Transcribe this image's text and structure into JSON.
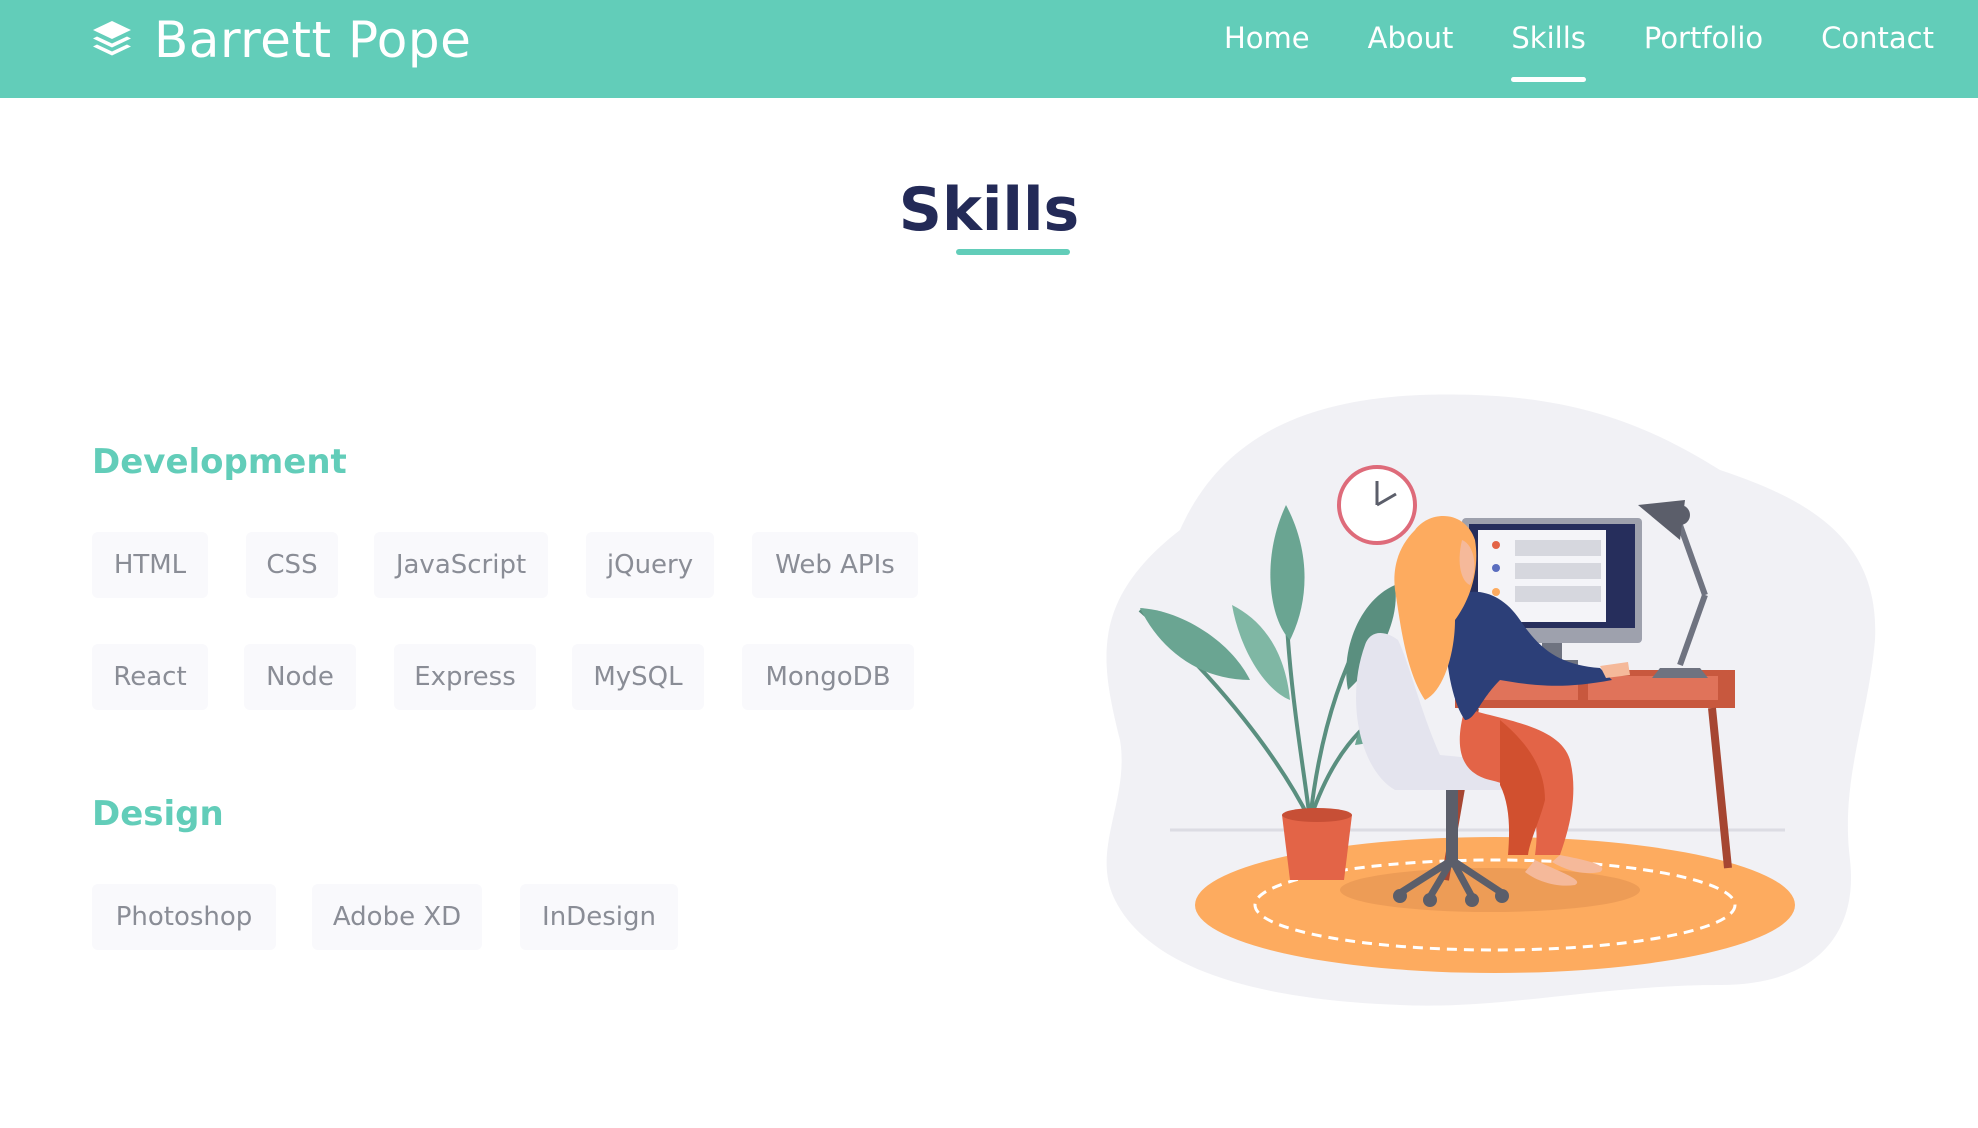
{
  "brand": {
    "name": "Barrett Pope",
    "icon": "layers-icon"
  },
  "nav": {
    "items": [
      "Home",
      "About",
      "Skills",
      "Portfolio",
      "Contact"
    ],
    "active": "Skills"
  },
  "section": {
    "title": "Skills"
  },
  "groups": [
    {
      "title": "Development",
      "skills": [
        "HTML",
        "CSS",
        "JavaScript",
        "jQuery",
        "Web APIs",
        "React",
        "Node",
        "Express",
        "MySQL",
        "MongoDB"
      ]
    },
    {
      "title": "Design",
      "skills": [
        "Photoshop",
        "Adobe XD",
        "InDesign"
      ]
    }
  ],
  "colors": {
    "accent": "#62cdb9",
    "heading": "#232a57",
    "chip_bg": "#f9f9fc",
    "chip_text": "#8a8d96"
  },
  "illustration": {
    "subject": "woman-at-computer-desk-illustration"
  }
}
